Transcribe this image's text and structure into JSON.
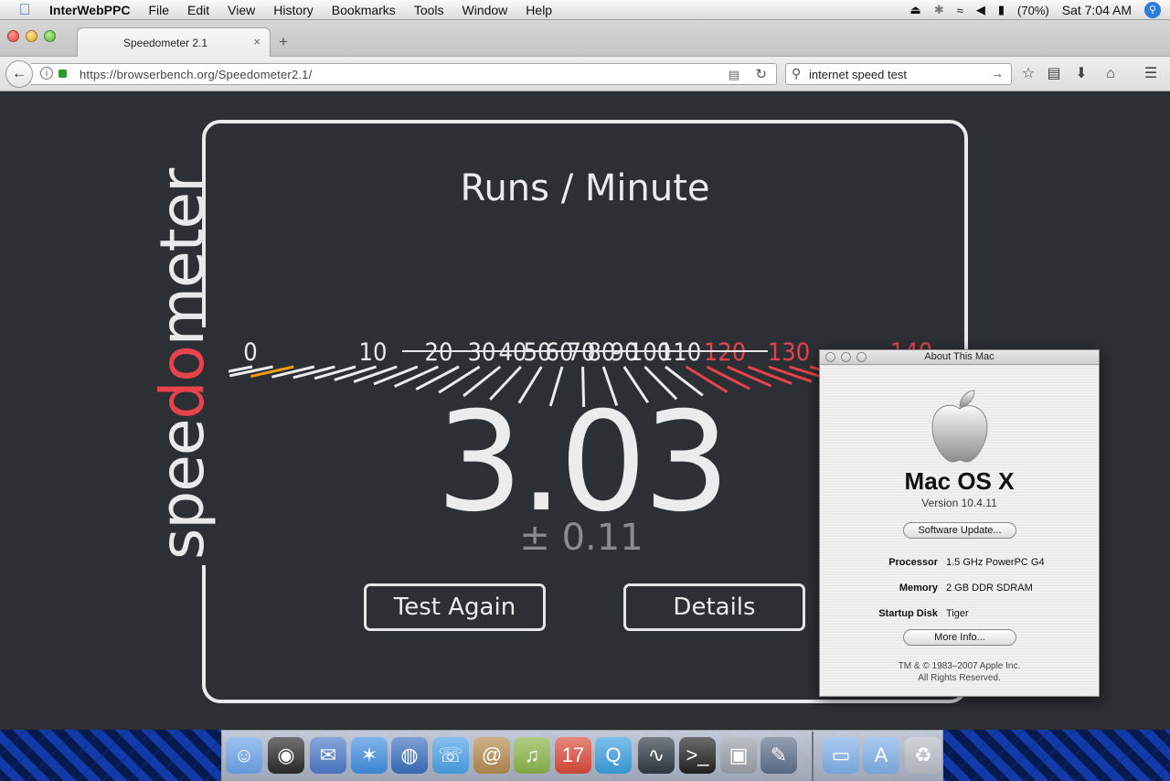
{
  "menubar": {
    "app_name": "InterWebPPC",
    "items": [
      "File",
      "Edit",
      "View",
      "History",
      "Bookmarks",
      "Tools",
      "Window",
      "Help"
    ],
    "battery": "(70%)",
    "clock": "Sat 7:04 AM"
  },
  "browser": {
    "tab_title": "Speedometer 2.1",
    "tab_close": "×",
    "new_tab": "+",
    "url": "https://browserbench.org/Speedometer2.1/",
    "search_query": "internet speed test"
  },
  "page": {
    "logo_text_a": "spee",
    "logo_text_b": "do",
    "logo_text_c": "meter",
    "units_title": "Runs / Minute",
    "tick_labels": [
      "0",
      "10",
      "20",
      "30",
      "40",
      "50",
      "60",
      "70",
      "80",
      "90",
      "100",
      "110",
      "120",
      "130",
      "140"
    ],
    "score": "3.03",
    "confidence": "± 0.11",
    "test_again_label": "Test Again",
    "details_label": "Details",
    "colors": {
      "accent": "#e8424c",
      "needle": "#f39c12",
      "text": "#ececec"
    }
  },
  "about": {
    "window_title": "About This Mac",
    "os_name": "Mac OS X",
    "version": "Version 10.4.11",
    "software_update_label": "Software Update...",
    "processor_label": "Processor",
    "processor_value": "1.5 GHz PowerPC G4",
    "memory_label": "Memory",
    "memory_value": "2 GB DDR SDRAM",
    "startup_label": "Startup Disk",
    "startup_value": "Tiger",
    "more_info_label": "More Info...",
    "copyright_line1": "TM & © 1983–2007 Apple Inc.",
    "copyright_line2": "All Rights Reserved."
  },
  "dock": {
    "apps": [
      "finder-icon",
      "dashboard-icon",
      "mail-icon",
      "safari-icon",
      "browser-icon",
      "ichat-icon",
      "address-book-icon",
      "itunes-icon",
      "ical-icon",
      "quicktime-icon",
      "activity-monitor-icon",
      "terminal-icon",
      "system-profiler-icon",
      "utility-icon"
    ],
    "right": [
      "documents-folder-icon",
      "applications-folder-icon",
      "trash-icon"
    ]
  }
}
